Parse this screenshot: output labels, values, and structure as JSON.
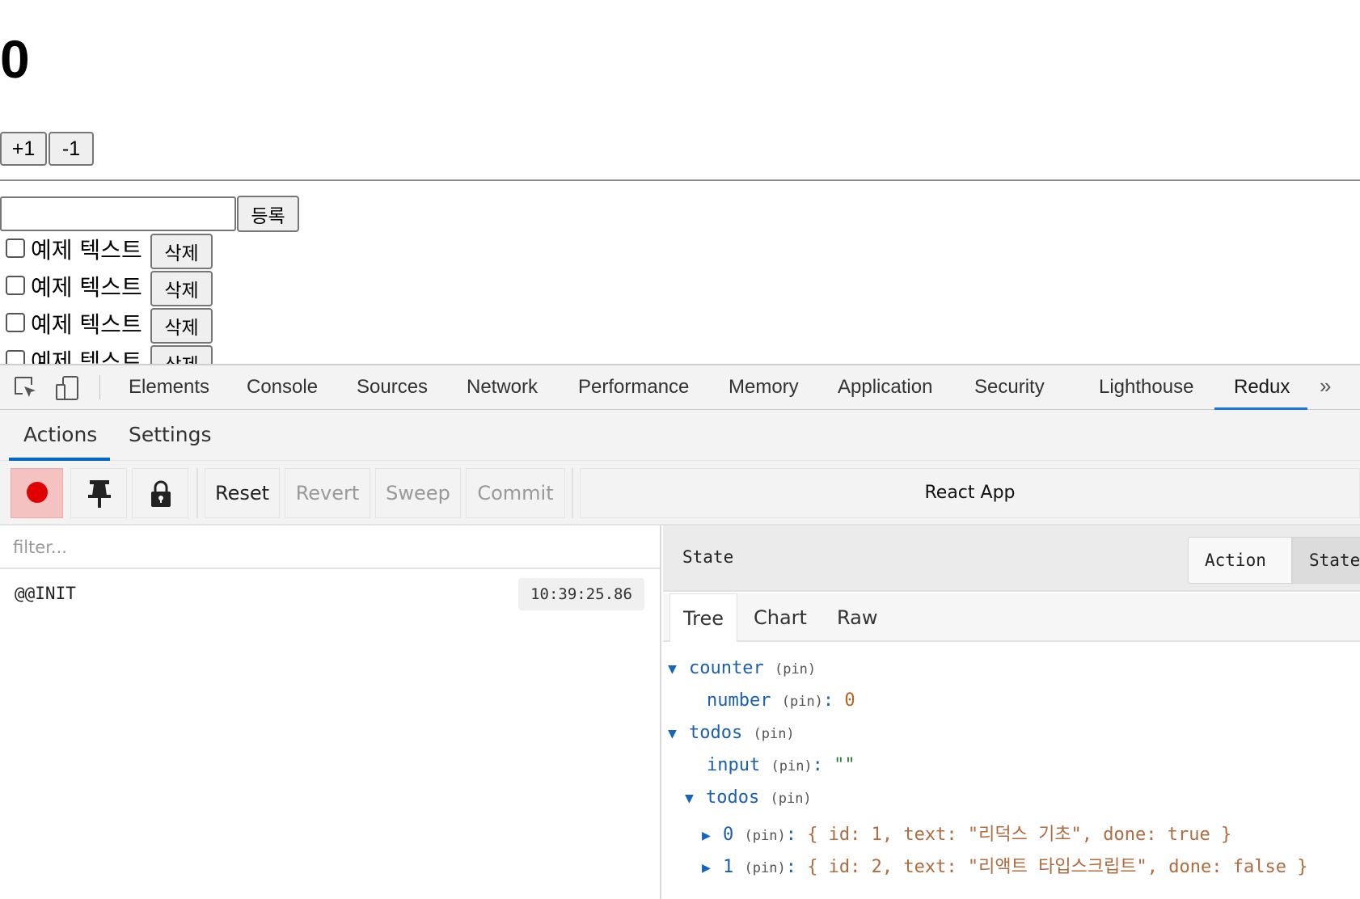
{
  "app": {
    "count": "0",
    "increment_label": "+1",
    "decrement_label": "-1",
    "todo_input_value": "",
    "register_label": "등록",
    "todos": [
      {
        "text": "예제 텍스트",
        "delete_label": "삭제",
        "done": false
      },
      {
        "text": "예제 텍스트",
        "delete_label": "삭제",
        "done": false
      },
      {
        "text": "예제 텍스트",
        "delete_label": "삭제",
        "done": false
      },
      {
        "text": "예제 텍스트",
        "delete_label": "삭제",
        "done": false
      }
    ]
  },
  "devtools": {
    "tabs": [
      "Elements",
      "Console",
      "Sources",
      "Network",
      "Performance",
      "Memory",
      "Application",
      "Security",
      "Lighthouse",
      "Redux"
    ],
    "active_tab": "Redux",
    "more_icon": "chevron-double-right-icon",
    "accent_color": "#1a73e8"
  },
  "redux": {
    "tabs": [
      "Actions",
      "Settings"
    ],
    "active_tab": "Actions",
    "toolbar": {
      "record_color": "#e00000",
      "reset": "Reset",
      "revert": "Revert",
      "sweep": "Sweep",
      "commit": "Commit",
      "instance": "React App"
    },
    "filter_placeholder": "filter...",
    "actions": [
      {
        "name": "@@INIT",
        "time": "10:39:25.86"
      }
    ],
    "inspector": {
      "title": "State",
      "modes": [
        "Action",
        "State"
      ],
      "active_mode": "State",
      "views": [
        "Tree",
        "Chart",
        "Raw"
      ],
      "active_view": "Tree",
      "pin": "(pin)",
      "tree": {
        "counter_key": "counter",
        "number_key": "number",
        "number_value": "0",
        "todos_key": "todos",
        "input_key": "input",
        "input_value": "\"\"",
        "todos_list_key": "todos",
        "item0_key": "0",
        "item0_value": "{ id: 1, text: \"리덕스 기초\", done: true }",
        "item1_key": "1",
        "item1_value": "{ id: 2, text: \"리액트 타입스크립트\", done: false }"
      }
    }
  }
}
